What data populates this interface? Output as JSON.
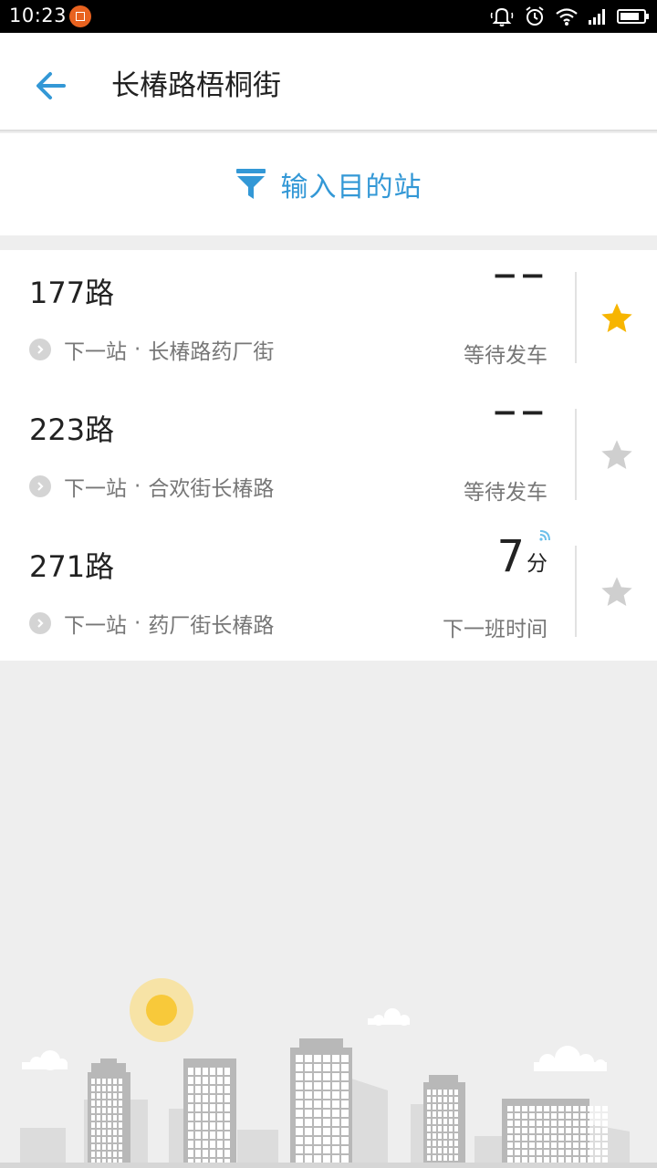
{
  "status_bar": {
    "time": "10:23",
    "icons": [
      "app-notification-icon",
      "bell-icon",
      "alarm-icon",
      "wifi-icon",
      "signal-icon",
      "battery-icon"
    ]
  },
  "header": {
    "back_icon": "arrow-left-icon",
    "title": "长椿路梧桐街"
  },
  "filter": {
    "icon": "funnel-icon",
    "label": "输入目的站"
  },
  "colors": {
    "accent": "#3398d6",
    "star_active": "#f7b500",
    "star_inactive": "#cfcfcf"
  },
  "routes": [
    {
      "name": "177路",
      "next_prefix": "下一站",
      "dot": "·",
      "next_station": "长椿路药厂街",
      "status_main": "−−",
      "status_sub": "等待发车",
      "favorite": true
    },
    {
      "name": "223路",
      "next_prefix": "下一站",
      "dot": "·",
      "next_station": "合欢街长椿路",
      "status_main": "−−",
      "status_sub": "等待发车",
      "favorite": false
    },
    {
      "name": "271路",
      "next_prefix": "下一站",
      "dot": "·",
      "next_station": "药厂街长椿路",
      "eta_value": "7",
      "eta_unit": "分",
      "status_sub": "下一班时间",
      "favorite": false
    }
  ]
}
